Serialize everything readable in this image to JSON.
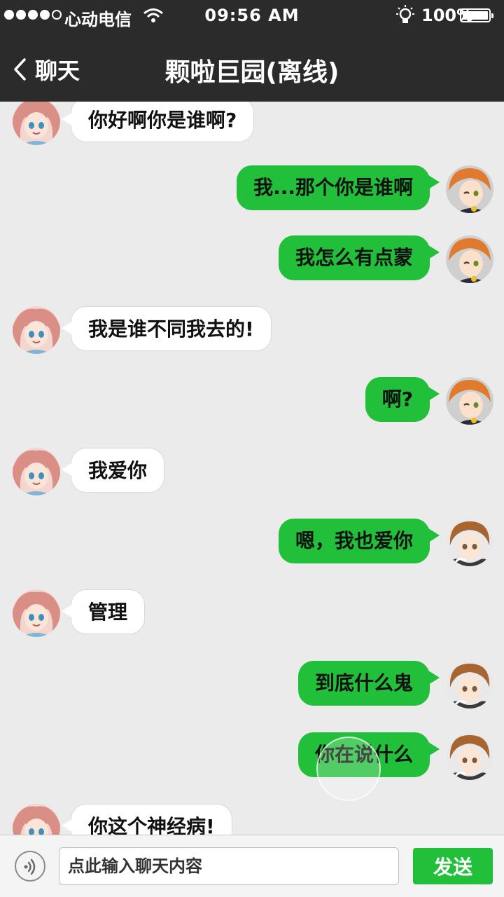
{
  "status_bar": {
    "carrier": "心动电信",
    "time": "09:56 AM",
    "battery": "100%"
  },
  "nav": {
    "back_label": "聊天",
    "title": "颗啦巨园(离线)"
  },
  "messages": [
    {
      "side": "left",
      "avatar": "girl-avatar",
      "text": "你好啊你是谁啊?"
    },
    {
      "side": "right",
      "avatar": "orange-hair-boy-avatar",
      "text": "我...那个你是谁啊"
    },
    {
      "side": "right",
      "avatar": "orange-hair-boy-avatar",
      "text": "我怎么有点蒙"
    },
    {
      "side": "left",
      "avatar": "girl-avatar",
      "text": "我是谁不同我去的!"
    },
    {
      "side": "right",
      "avatar": "orange-hair-boy-avatar",
      "text": "啊?"
    },
    {
      "side": "left",
      "avatar": "girl-avatar",
      "text": "我爱你"
    },
    {
      "side": "right",
      "avatar": "brown-hair-boy-avatar",
      "text": "嗯，我也爱你"
    },
    {
      "side": "left",
      "avatar": "girl-avatar",
      "text": "管理"
    },
    {
      "side": "right",
      "avatar": "brown-hair-boy-avatar",
      "text": "到底什么鬼"
    },
    {
      "side": "right",
      "avatar": "brown-hair-boy-avatar",
      "text": "你在说什么"
    },
    {
      "side": "left",
      "avatar": "girl-avatar",
      "text": "你这个神经病!"
    }
  ],
  "input": {
    "placeholder": "点此输入聊天内容",
    "send_label": "发送"
  },
  "colors": {
    "header": "#2b2b2b",
    "chat_bg": "#ebebeb",
    "bubble_green": "#22bf3a",
    "bubble_white": "#ffffff"
  }
}
